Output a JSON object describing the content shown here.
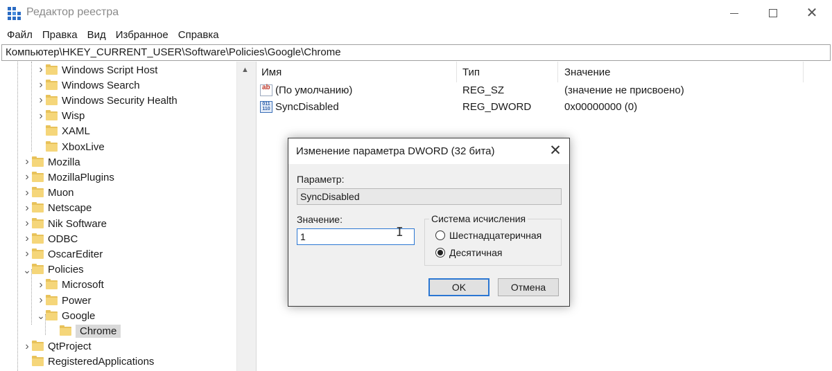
{
  "window": {
    "title": "Редактор реестра"
  },
  "menu": [
    "Файл",
    "Правка",
    "Вид",
    "Избранное",
    "Справка"
  ],
  "address": "Компьютер\\HKEY_CURRENT_USER\\Software\\Policies\\Google\\Chrome",
  "tree": {
    "items": [
      {
        "label": "Windows Script Host",
        "level": 1,
        "expander": ">"
      },
      {
        "label": "Windows Search",
        "level": 1,
        "expander": ">"
      },
      {
        "label": "Windows Security Health",
        "level": 1,
        "expander": ">"
      },
      {
        "label": "Wisp",
        "level": 1,
        "expander": ">"
      },
      {
        "label": "XAML",
        "level": 1,
        "expander": ""
      },
      {
        "label": "XboxLive",
        "level": 1,
        "expander": ""
      },
      {
        "label": "Mozilla",
        "level": 0,
        "expander": ">"
      },
      {
        "label": "MozillaPlugins",
        "level": 0,
        "expander": ">"
      },
      {
        "label": "Muon",
        "level": 0,
        "expander": ">"
      },
      {
        "label": "Netscape",
        "level": 0,
        "expander": ">"
      },
      {
        "label": "Nik Software",
        "level": 0,
        "expander": ">"
      },
      {
        "label": "ODBC",
        "level": 0,
        "expander": ">"
      },
      {
        "label": "OscarEditer",
        "level": 0,
        "expander": ">"
      },
      {
        "label": "Policies",
        "level": 0,
        "expander": "v"
      },
      {
        "label": "Microsoft",
        "level": 1,
        "expander": ">"
      },
      {
        "label": "Power",
        "level": 1,
        "expander": ">"
      },
      {
        "label": "Google",
        "level": 1,
        "expander": "v"
      },
      {
        "label": "Chrome",
        "level": 2,
        "expander": "",
        "selected": true
      },
      {
        "label": "QtProject",
        "level": 0,
        "expander": ">"
      },
      {
        "label": "RegisteredApplications",
        "level": 0,
        "expander": ""
      }
    ]
  },
  "list": {
    "columns": [
      "Имя",
      "Тип",
      "Значение"
    ],
    "rows": [
      {
        "icon": "string-value-icon",
        "name": "(По умолчанию)",
        "type": "REG_SZ",
        "value": "(значение не присвоено)"
      },
      {
        "icon": "dword-value-icon",
        "name": "SyncDisabled",
        "type": "REG_DWORD",
        "value": "0x00000000 (0)"
      }
    ]
  },
  "dialog": {
    "title": "Изменение параметра DWORD (32 бита)",
    "param_label": "Параметр:",
    "param_value": "SyncDisabled",
    "value_label": "Значение:",
    "value_input": "1",
    "base_group_label": "Система исчисления",
    "radio_hex": "Шестнадцатеричная",
    "radio_dec": "Десятичная",
    "selected_base": "Десятичная",
    "ok_label": "OK",
    "cancel_label": "Отмена"
  },
  "colors": {
    "accent": "#2a76d2",
    "folder": "#f5d67a",
    "selected_row": "#d9d9d9"
  }
}
